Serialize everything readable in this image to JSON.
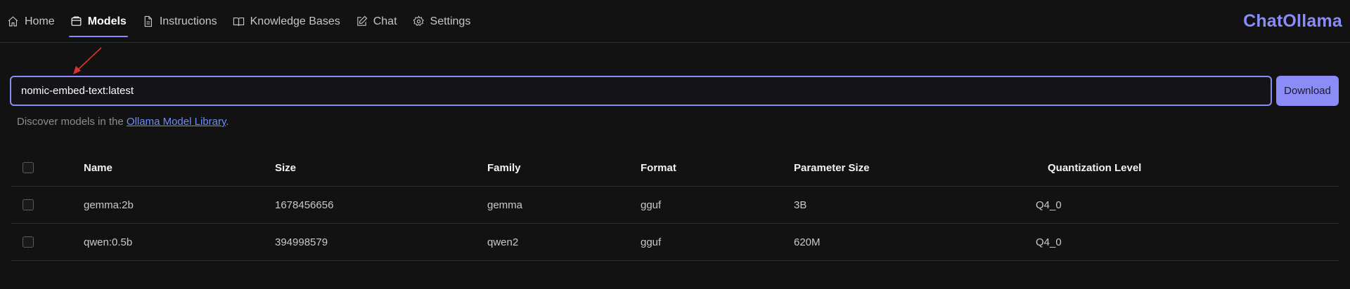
{
  "nav": {
    "items": [
      {
        "label": "Home",
        "icon": "home-icon"
      },
      {
        "label": "Models",
        "icon": "models-icon",
        "active": true
      },
      {
        "label": "Instructions",
        "icon": "document-icon"
      },
      {
        "label": "Knowledge Bases",
        "icon": "book-icon"
      },
      {
        "label": "Chat",
        "icon": "chat-edit-icon"
      },
      {
        "label": "Settings",
        "icon": "gear-icon"
      }
    ]
  },
  "brand": "ChatOllama",
  "download": {
    "input_value": "nomic-embed-text:latest",
    "button_label": "Download"
  },
  "hint": {
    "prefix": "Discover models in the ",
    "link": "Ollama Model Library",
    "suffix": "."
  },
  "table": {
    "columns": [
      "Name",
      "Size",
      "Family",
      "Format",
      "Parameter Size",
      "Quantization Level"
    ],
    "rows": [
      [
        "gemma:2b",
        "1678456656",
        "gemma",
        "gguf",
        "3B",
        "Q4_0"
      ],
      [
        "qwen:0.5b",
        "394998579",
        "qwen2",
        "gguf",
        "620M",
        "Q4_0"
      ]
    ]
  },
  "colors": {
    "accent": "#8b8cf5",
    "background": "#121212",
    "link": "#6b8ef8",
    "annotation_arrow": "#e0322b"
  }
}
